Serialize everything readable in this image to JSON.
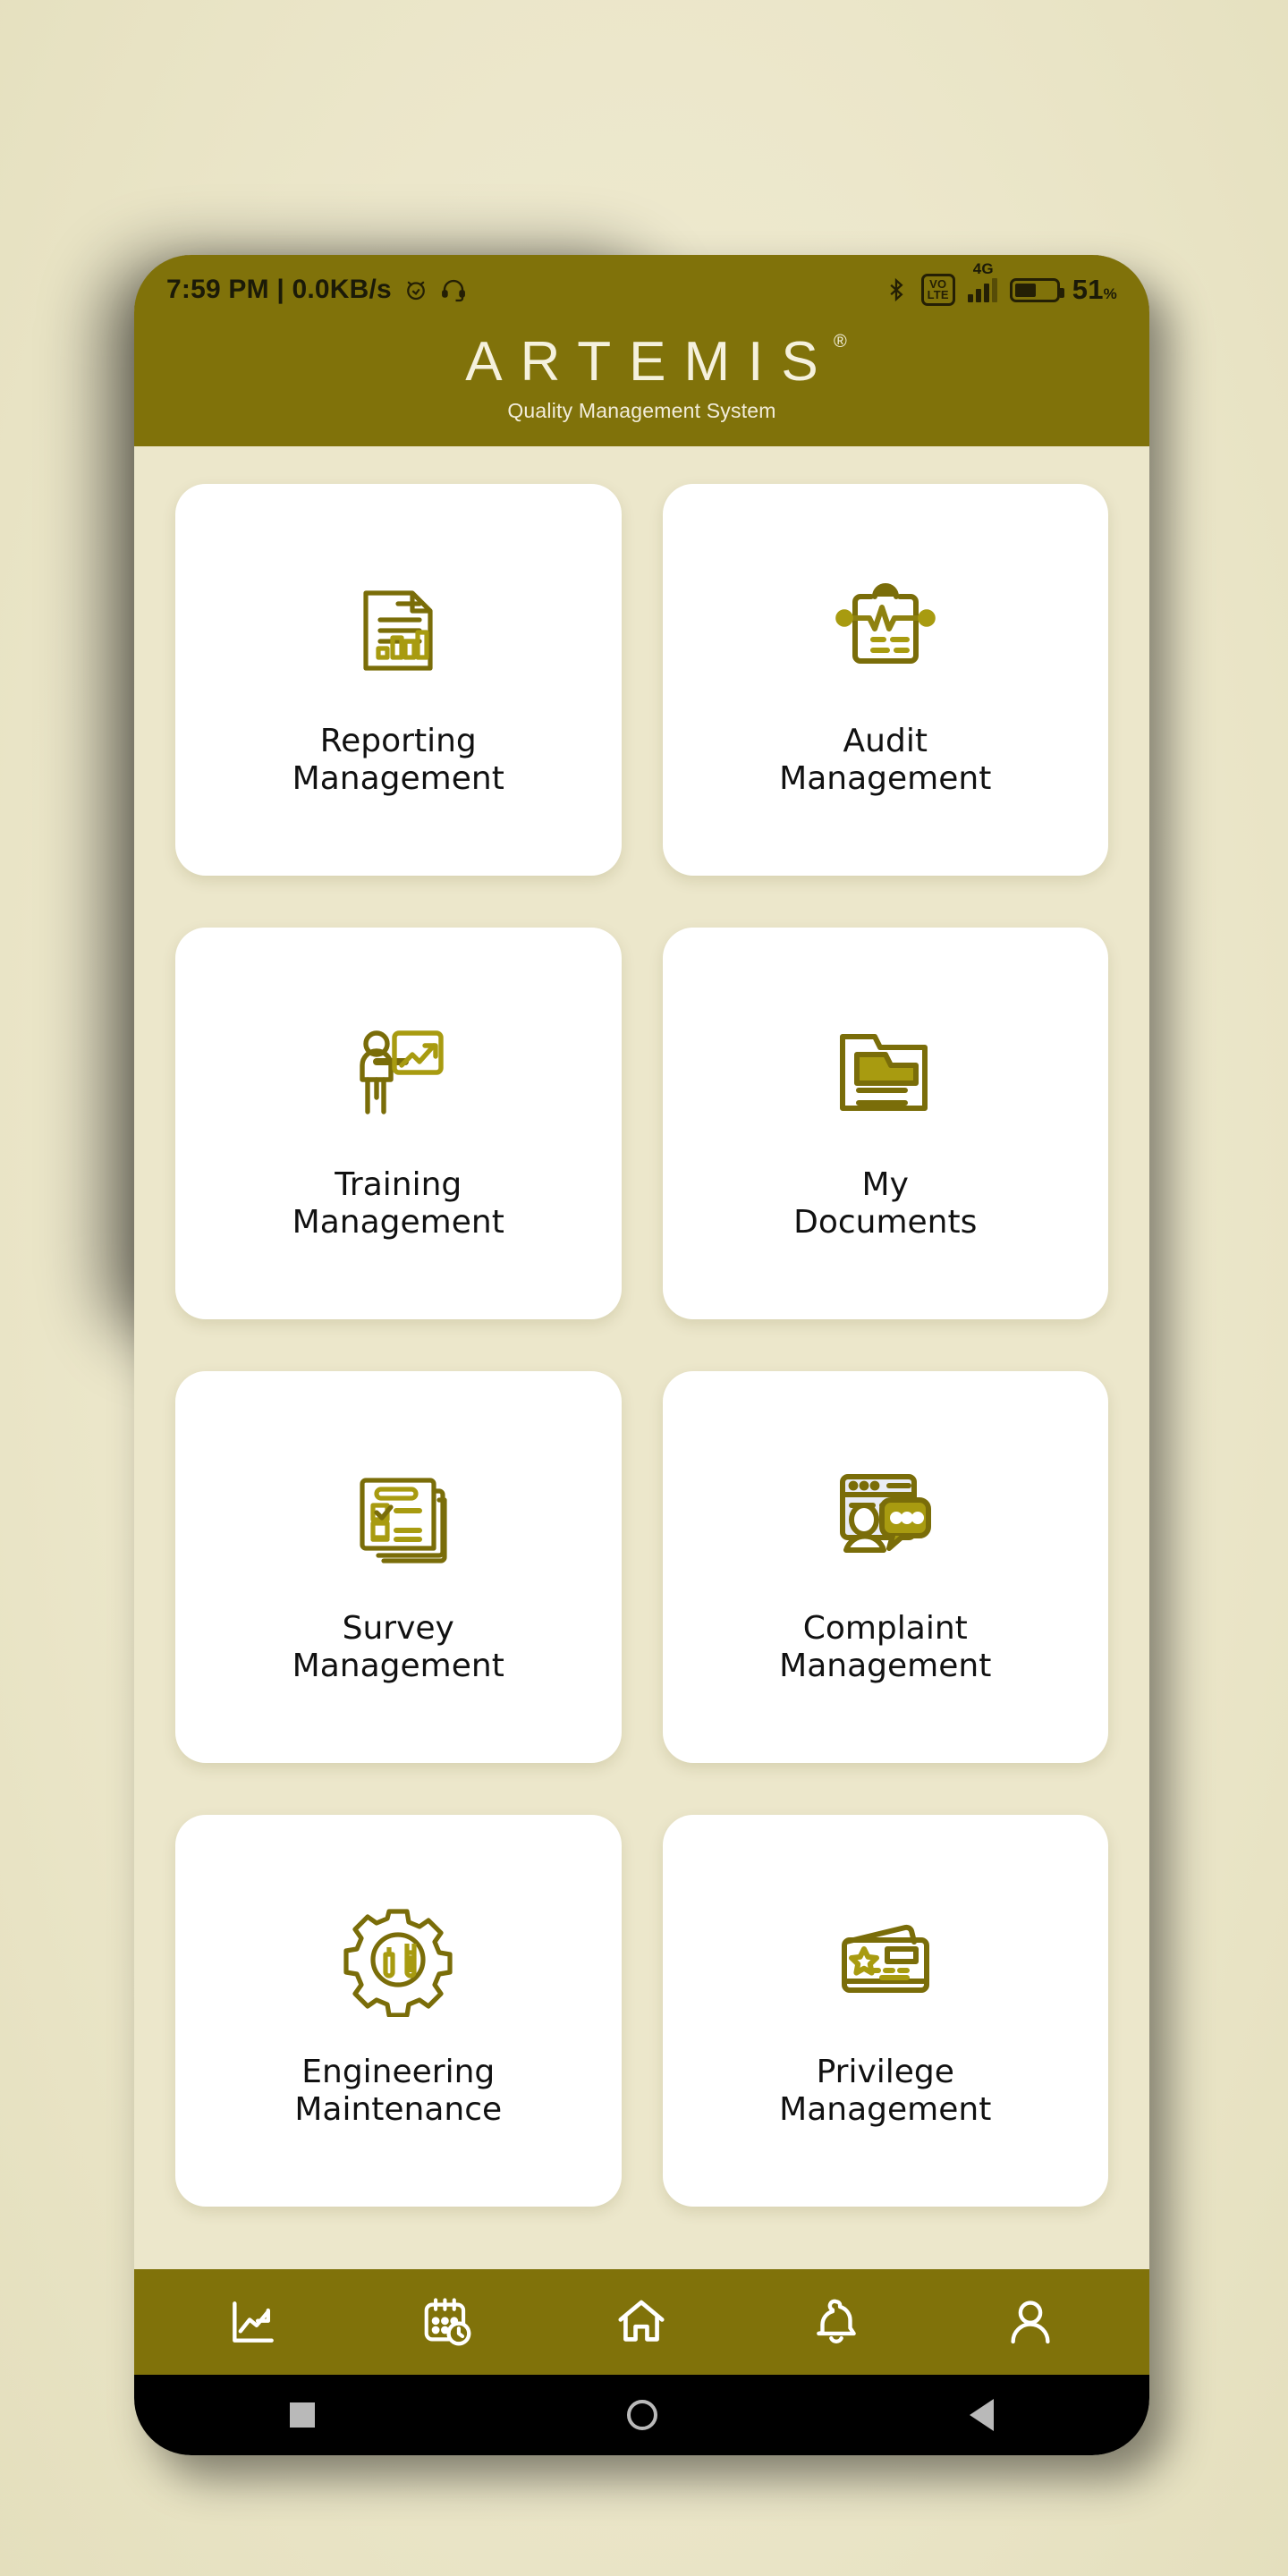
{
  "statusbar": {
    "time_and_speed": "7:59 PM | 0.0KB/s",
    "alarm_icon": "alarm-icon",
    "headset_icon": "headset-icon",
    "bluetooth_icon": "bluetooth-icon",
    "volte_label": "VoLTE",
    "network_type": "4G",
    "signal_icon": "signal-bars-icon",
    "battery_icon": "battery-icon",
    "battery_percent": "51",
    "battery_percent_symbol": "%"
  },
  "header": {
    "brand": "ARTEMIS",
    "registered_mark": "®",
    "tagline": "Quality Management System",
    "brand_color": "#80720a"
  },
  "grid": {
    "cards": [
      {
        "label_line1": "Reporting",
        "label_line2": "Management",
        "icon": "report-document-chart-icon"
      },
      {
        "label_line1": "Audit",
        "label_line2": "Management",
        "icon": "clipboard-pulse-icon"
      },
      {
        "label_line1": "Training",
        "label_line2": "Management",
        "icon": "presenter-whiteboard-icon"
      },
      {
        "label_line1": "My",
        "label_line2": "Documents",
        "icon": "folder-documents-icon"
      },
      {
        "label_line1": "Survey",
        "label_line2": "Management",
        "icon": "checklist-pages-icon"
      },
      {
        "label_line1": "Complaint",
        "label_line2": "Management",
        "icon": "person-chat-bubble-icon"
      },
      {
        "label_line1": "Engineering",
        "label_line2": "Maintenance",
        "icon": "gear-tools-icon"
      },
      {
        "label_line1": "Privilege",
        "label_line2": "Management",
        "icon": "privilege-card-icon"
      }
    ]
  },
  "bottomnav": {
    "items": [
      {
        "icon": "analytics-chart-icon"
      },
      {
        "icon": "calendar-clock-icon"
      },
      {
        "icon": "home-icon"
      },
      {
        "icon": "bell-icon"
      },
      {
        "icon": "person-icon"
      }
    ]
  },
  "androidnav": {
    "recents_icon": "recents-square-icon",
    "home_icon": "home-circle-icon",
    "back_icon": "back-triangle-icon"
  },
  "colors": {
    "accent": "#80720a",
    "icon_dark": "#766a09",
    "icon_light": "#a89b10",
    "page_bg": "#ece7cb",
    "card_bg": "#ffffff"
  }
}
